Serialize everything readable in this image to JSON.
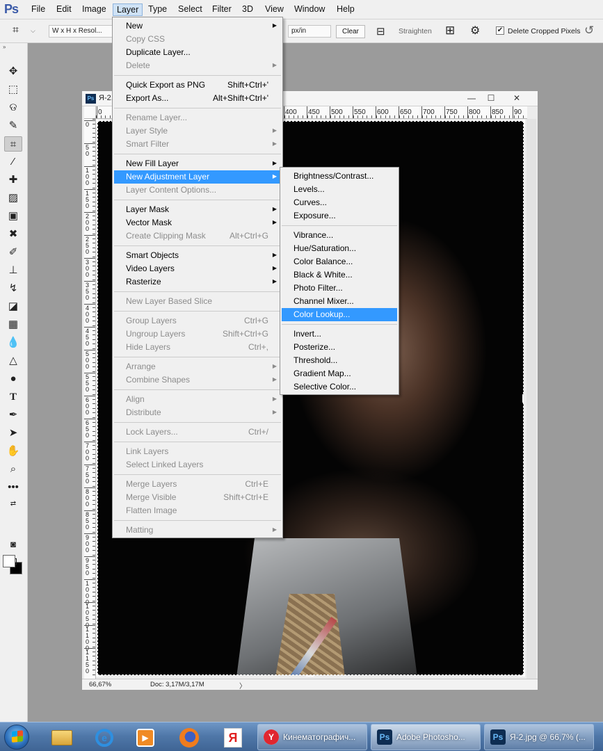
{
  "app": {
    "logo": "Ps"
  },
  "menubar": {
    "items": [
      "File",
      "Edit",
      "Image",
      "Layer",
      "Type",
      "Select",
      "Filter",
      "3D",
      "View",
      "Window",
      "Help"
    ],
    "active": "Layer"
  },
  "options_bar": {
    "ratio_preset": "W x H x Resol...",
    "unit": "px/in",
    "clear_label": "Clear",
    "straighten_label": "Straighten",
    "delete_cropped_label": "Delete Cropped Pixels",
    "delete_cropped_checked": true
  },
  "tools": {
    "icons": [
      "move-tool-icon",
      "marquee-tool-icon",
      "lasso-tool-icon",
      "quick-select-tool-icon",
      "crop-tool-icon",
      "eyedropper-tool-icon",
      "healing-brush-icon",
      "patch-tool-icon",
      "frame-tool-icon",
      "content-move-icon",
      "brush-tool-icon",
      "clone-stamp-icon",
      "history-brush-icon",
      "eraser-tool-icon",
      "gradient-tool-icon",
      "blur-tool-icon",
      "sharpen-tool-icon",
      "dodge-tool-icon",
      "type-tool-icon",
      "pen-tool-icon",
      "path-select-icon",
      "hand-tool-icon",
      "zoom-tool-icon",
      "more-tools-icon"
    ],
    "active": "crop-tool-icon",
    "foreground_color": "#ffffff",
    "background_color": "#000000"
  },
  "document": {
    "title": "Я-2.",
    "window_buttons": [
      "—",
      "☐",
      "✕"
    ],
    "ruler_h_labels": [
      "0",
      "400",
      "450",
      "500",
      "550",
      "600",
      "650",
      "700",
      "750",
      "800",
      "850",
      "90"
    ],
    "ruler_v_labels": [
      "0",
      "5\n0",
      "1\n0\n0",
      "1\n5\n0",
      "2\n0\n0",
      "2\n5\n0",
      "3\n0\n0",
      "3\n5\n0",
      "4\n0\n0",
      "4\n5\n0",
      "5\n0\n0",
      "5\n5\n0",
      "6\n0\n0",
      "6\n5\n0",
      "7\n0\n0",
      "7\n5\n0",
      "8\n0\n0",
      "8\n5\n0",
      "9\n0\n0",
      "9\n5\n0",
      "1\n0\n0\n0",
      "1\n0\n5\n0",
      "1\n1\n0\n0",
      "1\n1\n5\n0"
    ],
    "zoom": "66,67%",
    "doc_info": "Doc: 3,17M/3,17M"
  },
  "layer_menu": {
    "items": [
      {
        "label": "New",
        "arrow": true
      },
      {
        "label": "Copy CSS",
        "disabled": true
      },
      {
        "label": "Duplicate Layer..."
      },
      {
        "label": "Delete",
        "disabled": true,
        "arrow": true
      },
      {
        "sep": true
      },
      {
        "label": "Quick Export as PNG",
        "shortcut": "Shift+Ctrl+'"
      },
      {
        "label": "Export As...",
        "shortcut": "Alt+Shift+Ctrl+'"
      },
      {
        "sep": true
      },
      {
        "label": "Rename Layer...",
        "disabled": true
      },
      {
        "label": "Layer Style",
        "disabled": true,
        "arrow": true
      },
      {
        "label": "Smart Filter",
        "disabled": true,
        "arrow": true
      },
      {
        "sep": true
      },
      {
        "label": "New Fill Layer",
        "arrow": true
      },
      {
        "label": "New Adjustment Layer",
        "arrow": true,
        "highlighted": true
      },
      {
        "label": "Layer Content Options...",
        "disabled": true
      },
      {
        "sep": true
      },
      {
        "label": "Layer Mask",
        "arrow": true
      },
      {
        "label": "Vector Mask",
        "arrow": true
      },
      {
        "label": "Create Clipping Mask",
        "disabled": true,
        "shortcut": "Alt+Ctrl+G"
      },
      {
        "sep": true
      },
      {
        "label": "Smart Objects",
        "arrow": true
      },
      {
        "label": "Video Layers",
        "arrow": true
      },
      {
        "label": "Rasterize",
        "arrow": true
      },
      {
        "sep": true
      },
      {
        "label": "New Layer Based Slice",
        "disabled": true
      },
      {
        "sep": true
      },
      {
        "label": "Group Layers",
        "disabled": true,
        "shortcut": "Ctrl+G"
      },
      {
        "label": "Ungroup Layers",
        "disabled": true,
        "shortcut": "Shift+Ctrl+G"
      },
      {
        "label": "Hide Layers",
        "disabled": true,
        "shortcut": "Ctrl+,"
      },
      {
        "sep": true
      },
      {
        "label": "Arrange",
        "disabled": true,
        "arrow": true
      },
      {
        "label": "Combine Shapes",
        "disabled": true,
        "arrow": true
      },
      {
        "sep": true
      },
      {
        "label": "Align",
        "disabled": true,
        "arrow": true
      },
      {
        "label": "Distribute",
        "disabled": true,
        "arrow": true
      },
      {
        "sep": true
      },
      {
        "label": "Lock Layers...",
        "disabled": true,
        "shortcut": "Ctrl+/"
      },
      {
        "sep": true
      },
      {
        "label": "Link Layers",
        "disabled": true
      },
      {
        "label": "Select Linked Layers",
        "disabled": true
      },
      {
        "sep": true
      },
      {
        "label": "Merge Layers",
        "disabled": true,
        "shortcut": "Ctrl+E"
      },
      {
        "label": "Merge Visible",
        "disabled": true,
        "shortcut": "Shift+Ctrl+E"
      },
      {
        "label": "Flatten Image",
        "disabled": true
      },
      {
        "sep": true
      },
      {
        "label": "Matting",
        "disabled": true,
        "arrow": true
      }
    ]
  },
  "adjustment_submenu": {
    "items": [
      {
        "label": "Brightness/Contrast..."
      },
      {
        "label": "Levels..."
      },
      {
        "label": "Curves..."
      },
      {
        "label": "Exposure..."
      },
      {
        "sep": true
      },
      {
        "label": "Vibrance..."
      },
      {
        "label": "Hue/Saturation..."
      },
      {
        "label": "Color Balance..."
      },
      {
        "label": "Black & White..."
      },
      {
        "label": "Photo Filter..."
      },
      {
        "label": "Channel Mixer..."
      },
      {
        "label": "Color Lookup...",
        "highlighted": true
      },
      {
        "sep": true
      },
      {
        "label": "Invert..."
      },
      {
        "label": "Posterize..."
      },
      {
        "label": "Threshold..."
      },
      {
        "label": "Gradient Map..."
      },
      {
        "label": "Selective Color..."
      }
    ]
  },
  "taskbar": {
    "pinned": [
      "explorer-icon",
      "internet-explorer-icon",
      "media-player-icon",
      "firefox-icon",
      "yandex-icon"
    ],
    "tasks": [
      {
        "label": "Кинематографич...",
        "icon": "yandex-browser-icon"
      },
      {
        "label": "Adobe Photosho...",
        "icon": "photoshop-icon"
      },
      {
        "label": "Я-2.jpg @ 66,7% (...",
        "icon": "photoshop-icon"
      }
    ]
  },
  "colors": {
    "menu_highlight": "#3399ff",
    "menu_bg": "#f0f0f0",
    "workspace_bg": "#9b9b9b"
  }
}
